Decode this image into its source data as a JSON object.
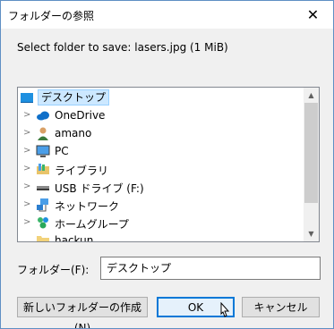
{
  "window": {
    "title": "フォルダーの参照",
    "close_glyph": "✕"
  },
  "prompt": "Select folder to save: lasers.jpg (1 MiB)",
  "tree": {
    "root": {
      "label": "デスクトップ",
      "icon": "desktop-icon"
    },
    "items": [
      {
        "label": "OneDrive",
        "icon": "cloud-icon"
      },
      {
        "label": "amano",
        "icon": "user-icon"
      },
      {
        "label": "PC",
        "icon": "computer-icon"
      },
      {
        "label": "ライブラリ",
        "icon": "library-icon"
      },
      {
        "label": "USB ドライブ (F:)",
        "icon": "usb-drive-icon"
      },
      {
        "label": "ネットワーク",
        "icon": "network-icon"
      },
      {
        "label": "ホームグループ",
        "icon": "homegroup-icon"
      },
      {
        "label": "hackun",
        "icon": "folder-icon"
      }
    ]
  },
  "folder_field": {
    "label": "フォルダー(F):",
    "value": "デスクトップ"
  },
  "buttons": {
    "new_folder": "新しいフォルダーの作成(N)",
    "ok": "OK",
    "cancel": "キャンセル"
  }
}
